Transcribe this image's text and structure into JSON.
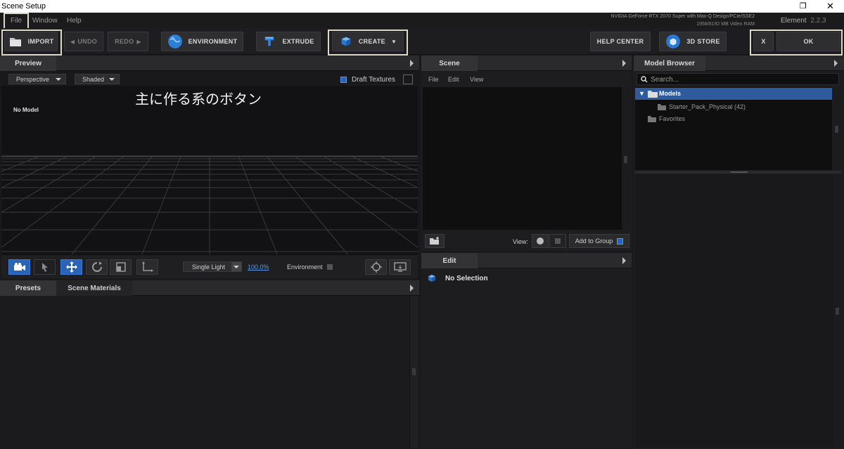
{
  "window": {
    "title": "Scene Setup",
    "restore_glyph": "❐",
    "close_glyph": "✕"
  },
  "menu": {
    "items": [
      "File",
      "Window",
      "Help"
    ]
  },
  "gpu": {
    "line1": "NVIDIA GeForce RTX 2070 Super with Max-Q Design/PCIe/SSE2",
    "line2": "1958/8192 MB Video RAM"
  },
  "app": {
    "name": "Element",
    "version": "2.2.3"
  },
  "toolbar": {
    "import": "IMPORT",
    "undo": "UNDO",
    "redo": "REDO",
    "environment": "ENVIRONMENT",
    "extrude": "EXTRUDE",
    "create": "CREATE",
    "help_center": "HELP CENTER",
    "store": "3D STORE",
    "cancel": "X",
    "ok": "OK"
  },
  "preview": {
    "tab": "Preview",
    "camera": "Perspective",
    "shading": "Shaded",
    "draft_textures": "Draft Textures",
    "no_model": "No Model",
    "light": "Single Light",
    "zoom": "100.0%",
    "environment_label": "Environment"
  },
  "annotation": "主に作る系のボタン",
  "scene": {
    "tab": "Scene",
    "menu": [
      "File",
      "Edit",
      "View"
    ],
    "view_label": "View:",
    "add_to_group": "Add to Group"
  },
  "edit": {
    "tab": "Edit",
    "selection": "No Selection"
  },
  "presets": {
    "tabs": [
      "Presets",
      "Scene Materials"
    ]
  },
  "model_browser": {
    "tab": "Model Browser",
    "search_placeholder": "Search...",
    "tree": {
      "root": "Models",
      "child": "Starter_Pack_Physical (42)",
      "favorites": "Favorites"
    }
  },
  "colors": {
    "accent_blue": "#2a64b8",
    "selected_row": "#2f5a9c",
    "highlight_box": "#dcd9c8"
  }
}
